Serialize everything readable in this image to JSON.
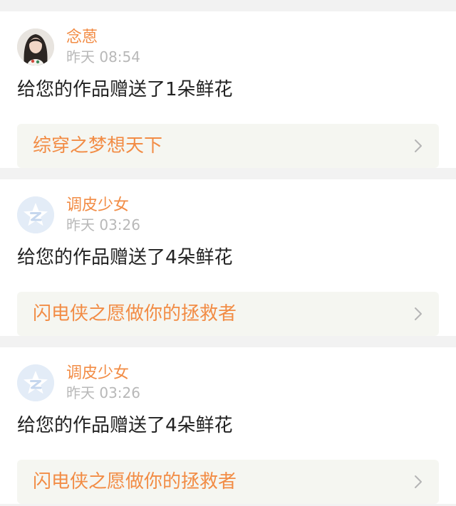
{
  "notifications": [
    {
      "username": "念蒽",
      "time": "昨天 08:54",
      "message": "给您的作品赠送了1朵鲜花",
      "work_title": "综穿之梦想天下",
      "avatar": "photo-avatar"
    },
    {
      "username": "调皮少女",
      "time": "昨天 03:26",
      "message": "给您的作品赠送了4朵鲜花",
      "work_title": "闪电侠之愿做你的拯救者",
      "avatar": "default-qzone-avatar"
    },
    {
      "username": "调皮少女",
      "time": "昨天 03:26",
      "message": "给您的作品赠送了4朵鲜花",
      "work_title": "闪电侠之愿做你的拯救者",
      "avatar": "default-qzone-avatar"
    }
  ],
  "colors": {
    "accent": "#f28c45",
    "page_bg": "#f2f2f2",
    "card_bg": "#ffffff",
    "work_bg": "#f5f6f1",
    "time": "#b8b8b8",
    "message": "#222222",
    "default_avatar_bg": "#e3ecf7"
  },
  "icons": {
    "chevron": "chevron-right-icon"
  }
}
